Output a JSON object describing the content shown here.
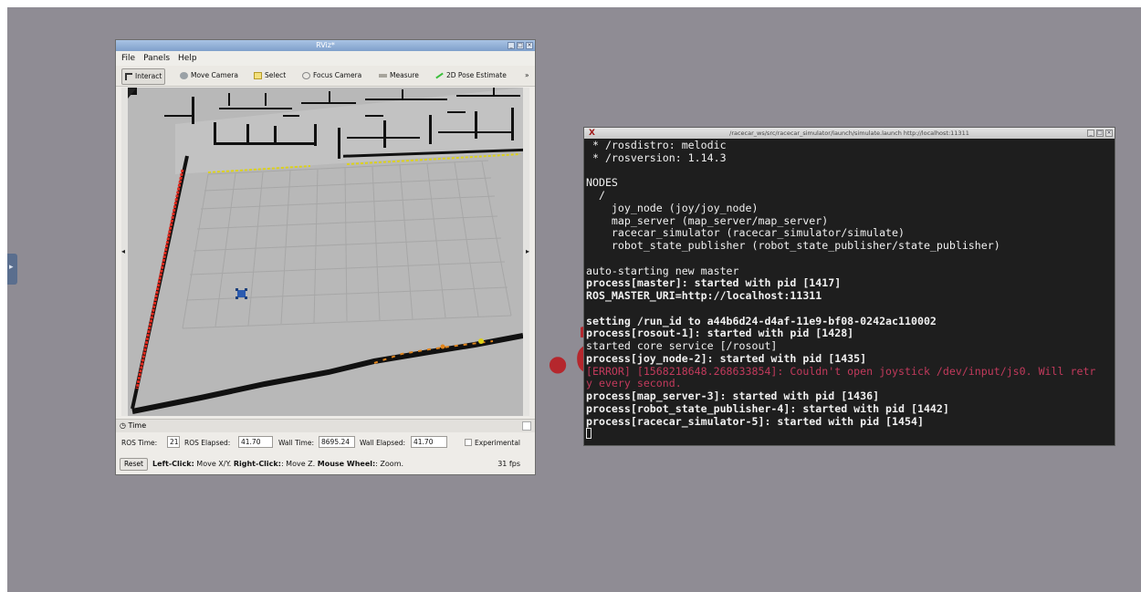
{
  "rviz": {
    "title": "RViz*",
    "menu": [
      "File",
      "Panels",
      "Help"
    ],
    "tools": [
      "Interact",
      "Move Camera",
      "Select",
      "Focus Camera",
      "Measure",
      "2D Pose Estimate"
    ],
    "more": "»",
    "time_panel": {
      "title": "Time",
      "ros_time_label": "ROS Time:",
      "ros_time": "21",
      "ros_elapsed_label": "ROS Elapsed:",
      "ros_elapsed": "41.70",
      "wall_time_label": "Wall Time:",
      "wall_time": "8695.24",
      "wall_elapsed_label": "Wall Elapsed:",
      "wall_elapsed": "41.70",
      "experimental_label": "Experimental",
      "experimental_checked": false
    },
    "status": {
      "reset": "Reset",
      "left_click": "Left-Click:",
      "left_click_desc": " Move X/Y. ",
      "right_click": "Right-Click:",
      "right_click_desc": ": Move Z. ",
      "wheel": "Mouse Wheel:",
      "wheel_desc": ": Zoom.",
      "fps": "31 fps"
    }
  },
  "background_letter": ".a",
  "terminal": {
    "title": "/racecar_ws/src/racecar_simulator/launch/simulate.launch http://localhost:11311",
    "lines": [
      {
        "text": " * /rosdistro: melodic",
        "style": "normal"
      },
      {
        "text": " * /rosversion: 1.14.3",
        "style": "normal"
      },
      {
        "text": "",
        "style": "normal"
      },
      {
        "text": "NODES",
        "style": "normal"
      },
      {
        "text": "  /",
        "style": "normal"
      },
      {
        "text": "    joy_node (joy/joy_node)",
        "style": "normal"
      },
      {
        "text": "    map_server (map_server/map_server)",
        "style": "normal"
      },
      {
        "text": "    racecar_simulator (racecar_simulator/simulate)",
        "style": "normal"
      },
      {
        "text": "    robot_state_publisher (robot_state_publisher/state_publisher)",
        "style": "normal"
      },
      {
        "text": "",
        "style": "normal"
      },
      {
        "text": "auto-starting new master",
        "style": "normal"
      },
      {
        "text": "process[master]: started with pid [1417]",
        "style": "bold"
      },
      {
        "text": "ROS_MASTER_URI=http://localhost:11311",
        "style": "bold"
      },
      {
        "text": "",
        "style": "normal"
      },
      {
        "text": "setting /run_id to a44b6d24-d4af-11e9-bf08-0242ac110002",
        "style": "bold"
      },
      {
        "text": "process[rosout-1]: started with pid [1428]",
        "style": "bold"
      },
      {
        "text": "started core service [/rosout]",
        "style": "normal"
      },
      {
        "text": "process[joy_node-2]: started with pid [1435]",
        "style": "bold"
      },
      {
        "text": "[ERROR] [1568218648.268633854]: Couldn't open joystick /dev/input/js0. Will retr",
        "style": "err"
      },
      {
        "text": "y every second.",
        "style": "err"
      },
      {
        "text": "process[map_server-3]: started with pid [1436]",
        "style": "bold"
      },
      {
        "text": "process[robot_state_publisher-4]: started with pid [1442]",
        "style": "bold"
      },
      {
        "text": "process[racecar_simulator-5]: started with pid [1454]",
        "style": "bold"
      }
    ]
  },
  "colors": {
    "desktop": "#8f8c94",
    "error_text": "#c23a5c",
    "laser_red": "#e32b1f",
    "laser_yellow": "#ddd21a",
    "robot_blue": "#2b5bb0"
  }
}
